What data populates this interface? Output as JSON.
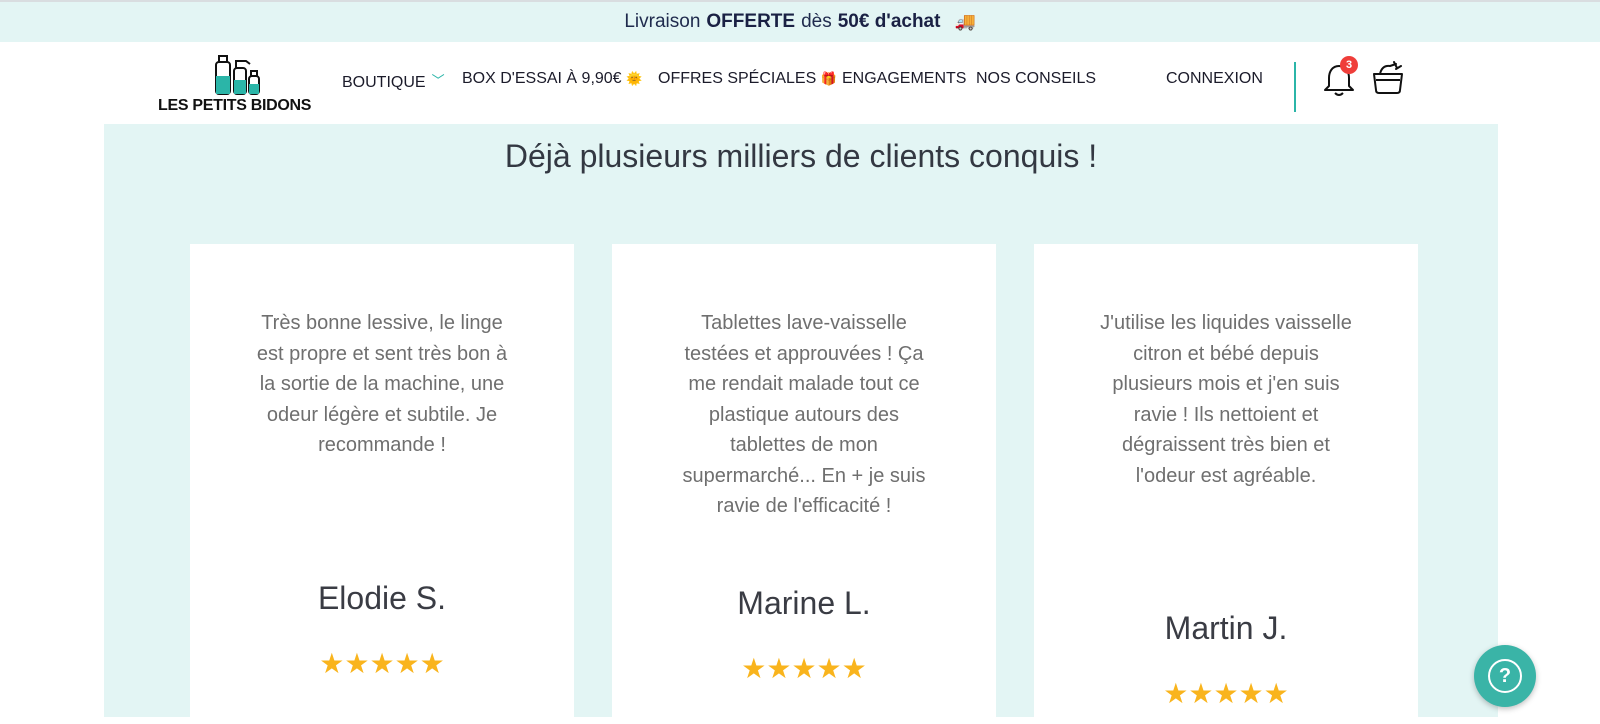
{
  "promo": {
    "prefix": "Livraison",
    "highlight": "OFFERTE",
    "middle": "dès",
    "amount": "50€ d'achat",
    "icon": "truck-icon"
  },
  "logo": {
    "text": "LES PETITS BIDONS",
    "icon": "bottles-icon"
  },
  "nav": {
    "items": [
      {
        "label": "BOUTIQUE",
        "icon": "chevron-down-icon"
      },
      {
        "label": "BOX D'ESSAI À 9,90€",
        "icon": "sun-icon"
      },
      {
        "label": "OFFRES SPÉCIALES",
        "icon": "gift-icon"
      },
      {
        "label": "ENGAGEMENTS"
      },
      {
        "label": "NOS CONSEILS"
      }
    ],
    "login": "CONNEXION",
    "notifications_count": "3",
    "accent": "#2bb5a8"
  },
  "testimonials": {
    "title": "Déjà plusieurs milliers de clients conquis !",
    "cards": [
      {
        "quote": "Très bonne lessive, le linge est propre et sent très bon à la sortie de la machine, une odeur légère et subtile. Je recommande !",
        "name": "Elodie S.",
        "stars": "★★★★★",
        "rating": 5
      },
      {
        "quote": "Tablettes lave-vaisselle testées et approuvées ! Ça me rendait malade tout ce plastique autours des tablettes de mon supermarché... En + je suis ravie de l'efficacité !",
        "name": "Marine L.",
        "stars": "★★★★★",
        "rating": 5
      },
      {
        "quote": "J'utilise les liquides vaisselle citron et bébé depuis plusieurs mois et j'en suis ravie ! Ils nettoient et dégraissent très bien et l'odeur est agréable.",
        "name": "Martin J.",
        "stars": "★★★★★",
        "rating": 5
      }
    ],
    "star_color": "#f9b41d",
    "background": "#e3f5f4"
  },
  "help": {
    "label": "?",
    "icon": "help-icon"
  }
}
